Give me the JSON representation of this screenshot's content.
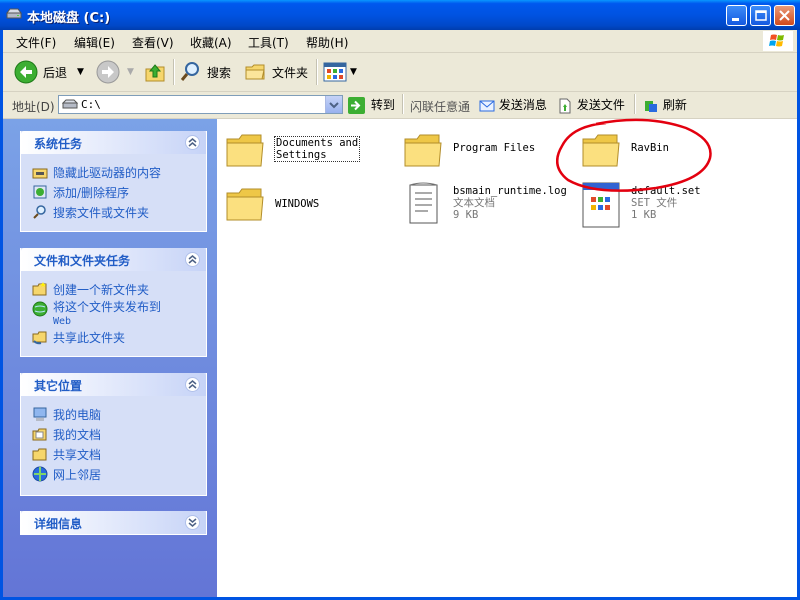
{
  "window": {
    "title": "本地磁盘 (C:)"
  },
  "menu": [
    "文件(F)",
    "编辑(E)",
    "查看(V)",
    "收藏(A)",
    "工具(T)",
    "帮助(H)"
  ],
  "toolbar": {
    "back": "后退",
    "search": "搜索",
    "folders": "文件夹"
  },
  "address": {
    "label": "地址(D)",
    "value": "C:\\",
    "go": "转到",
    "flash": "闪联任意通",
    "send_msg": "发送消息",
    "send_file": "发送文件",
    "refresh": "刷新"
  },
  "panels": [
    {
      "title": "系统任务",
      "items": [
        "隐藏此驱动器的内容",
        "添加/删除程序",
        "搜索文件或文件夹"
      ]
    },
    {
      "title": "文件和文件夹任务",
      "items": [
        "创建一个新文件夹",
        "将这个文件夹发布到",
        "Web",
        "共享此文件夹"
      ]
    },
    {
      "title": "其它位置",
      "items": [
        "我的电脑",
        "我的文档",
        "共享文档",
        "网上邻居"
      ]
    },
    {
      "title": "详细信息"
    }
  ],
  "files": [
    {
      "name_line1": "Documents and",
      "name_line2": "Settings",
      "type": "folder"
    },
    {
      "name": "Program Files",
      "type": "folder"
    },
    {
      "name": "RavBin",
      "type": "folder"
    },
    {
      "name": "WINDOWS",
      "type": "folder"
    },
    {
      "name": "bsmain_runtime.log",
      "desc": "文本文档",
      "size": "9 KB",
      "type": "text-file"
    },
    {
      "name": "default.set",
      "desc": "SET 文件",
      "size": "1 KB",
      "type": "set-file"
    }
  ],
  "colors": {
    "titlebar": "#0054e3",
    "taskpane": "#6375d6",
    "link": "#215dc6",
    "highlight_circle": "#e3000f"
  }
}
